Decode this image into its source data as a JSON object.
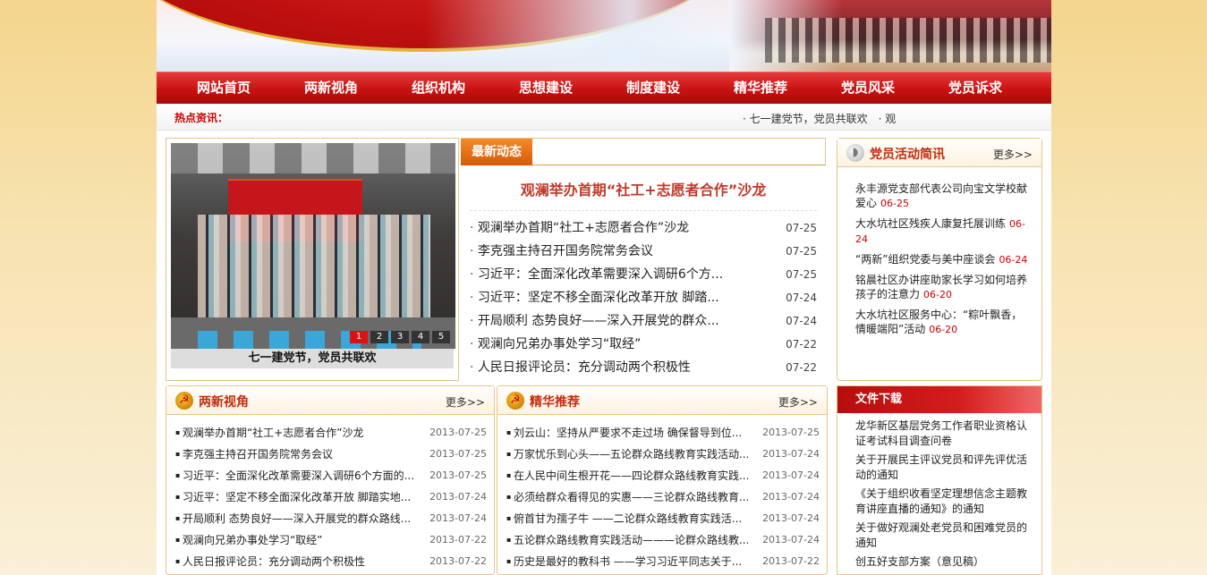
{
  "nav": [
    "网站首页",
    "两新视角",
    "组织机构",
    "思想建设",
    "制度建设",
    "精华推荐",
    "党员风采",
    "党员诉求"
  ],
  "hotbar": {
    "label": "热点资讯：",
    "items": [
      "· 七一建党节，党员共联欢",
      "· 观"
    ]
  },
  "slider": {
    "caption": "七一建党节，党员共联欢",
    "pages": [
      "1",
      "2",
      "3",
      "4",
      "5"
    ]
  },
  "latest": {
    "tab": "最新动态",
    "headline": "观澜举办首期“社工+志愿者合作”沙龙",
    "items": [
      {
        "title": "观澜举办首期“社工+志愿者合作”沙龙",
        "date": "07-25"
      },
      {
        "title": "李克强主持召开国务院常务会议",
        "date": "07-25"
      },
      {
        "title": "习近平：全面深化改革需要深入调研6个方...",
        "date": "07-25"
      },
      {
        "title": "习近平：坚定不移全面深化改革开放 脚踏...",
        "date": "07-24"
      },
      {
        "title": "开局顺利 态势良好——深入开展党的群众...",
        "date": "07-24"
      },
      {
        "title": "观澜向兄弟办事处学习“取经”",
        "date": "07-22"
      },
      {
        "title": "人民日报评论员：充分调动两个积极性",
        "date": "07-22"
      }
    ]
  },
  "activities": {
    "title": "党员活动简讯",
    "more": "更多>>",
    "items": [
      {
        "title": "永丰源党支部代表公司向宝文学校献爱心",
        "date": "06-25"
      },
      {
        "title": "大水坑社区残疾人康复托展训练",
        "date": "06-24"
      },
      {
        "title": "“两新”组织党委与美中座谈会",
        "date": "06-24"
      },
      {
        "title": "铭晨社区办讲座助家长学习如何培养孩子的注意力",
        "date": "06-20"
      },
      {
        "title": "大水坑社区服务中心：“粽叶飘香，情暖端阳”活动",
        "date": "06-20"
      }
    ]
  },
  "liangxin": {
    "title": "两新视角",
    "more": "更多>>",
    "items": [
      {
        "title": "观澜举办首期“社工+志愿者合作”沙龙",
        "date": "2013-07-25"
      },
      {
        "title": "李克强主持召开国务院常务会议",
        "date": "2013-07-25"
      },
      {
        "title": "习近平：全面深化改革需要深入调研6个方面的...",
        "date": "2013-07-25"
      },
      {
        "title": "习近平：坚定不移全面深化改革开放 脚踏实地...",
        "date": "2013-07-24"
      },
      {
        "title": "开局顺利 态势良好——深入开展党的群众路线...",
        "date": "2013-07-24"
      },
      {
        "title": "观澜向兄弟办事处学习“取经”",
        "date": "2013-07-22"
      },
      {
        "title": "人民日报评论员：充分调动两个积极性",
        "date": "2013-07-22"
      }
    ]
  },
  "jinghua": {
    "title": "精华推荐",
    "more": "更多>>",
    "items": [
      {
        "title": "刘云山：坚持从严要求不走过场 确保督导到位...",
        "date": "2013-07-25"
      },
      {
        "title": "万家忧乐到心头——五论群众路线教育实践活动...",
        "date": "2013-07-24"
      },
      {
        "title": "在人民中间生根开花——四论群众路线教育实践...",
        "date": "2013-07-24"
      },
      {
        "title": "必须给群众看得见的实惠——三论群众路线教育...",
        "date": "2013-07-24"
      },
      {
        "title": "俯首甘为孺子牛 ——二论群众路线教育实践活...",
        "date": "2013-07-24"
      },
      {
        "title": "五论群众路线教育实践活动———论群众路线教...",
        "date": "2013-07-24"
      },
      {
        "title": "历史是最好的教科书 ——学习习近平同志关于...",
        "date": "2013-07-22"
      }
    ]
  },
  "files": {
    "title": "文件下载",
    "items": [
      "龙华新区基层党务工作者职业资格认证考试科目调查问卷",
      "关于开展民主评议党员和评先评优活动的通知",
      "《关于组织收看坚定理想信念主题教育讲座直播的通知》的通知",
      "关于做好观澜处老党员和困难党员的通知",
      "创五好支部方案（意见稿）"
    ]
  },
  "colors": {
    "nav_red": "#c81212",
    "accent_orange": "#e06a10",
    "date_red": "#cc0000"
  }
}
